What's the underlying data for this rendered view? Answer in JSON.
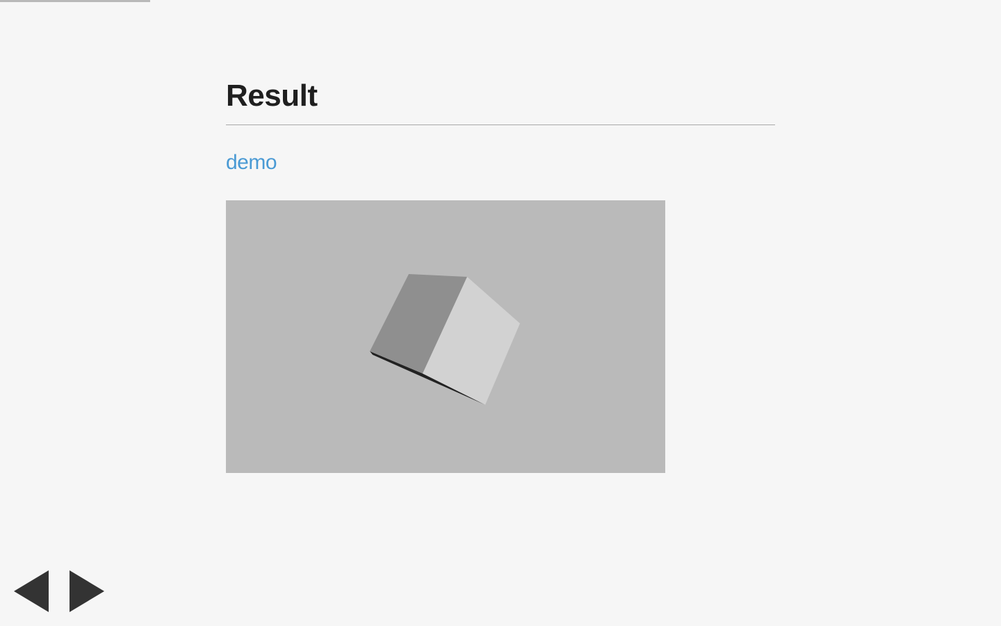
{
  "progress": {
    "fraction": 0.15
  },
  "slide": {
    "title": "Result",
    "link_text": "demo"
  },
  "demo": {
    "description_colors": {
      "background": "#bababa",
      "cube_left_face": "#8f8f8f",
      "cube_right_face": "#d2d2d2",
      "cube_edge_shadow": "#222222"
    }
  },
  "nav": {
    "prev_icon": "triangle-left-icon",
    "next_icon": "triangle-right-icon",
    "icon_color": "#333333"
  },
  "colors": {
    "page_background": "#f6f6f6",
    "link": "#4a9ad4",
    "title": "#1f1f1f",
    "rule": "#a8a8a8",
    "progress": "#b9b9b9"
  }
}
